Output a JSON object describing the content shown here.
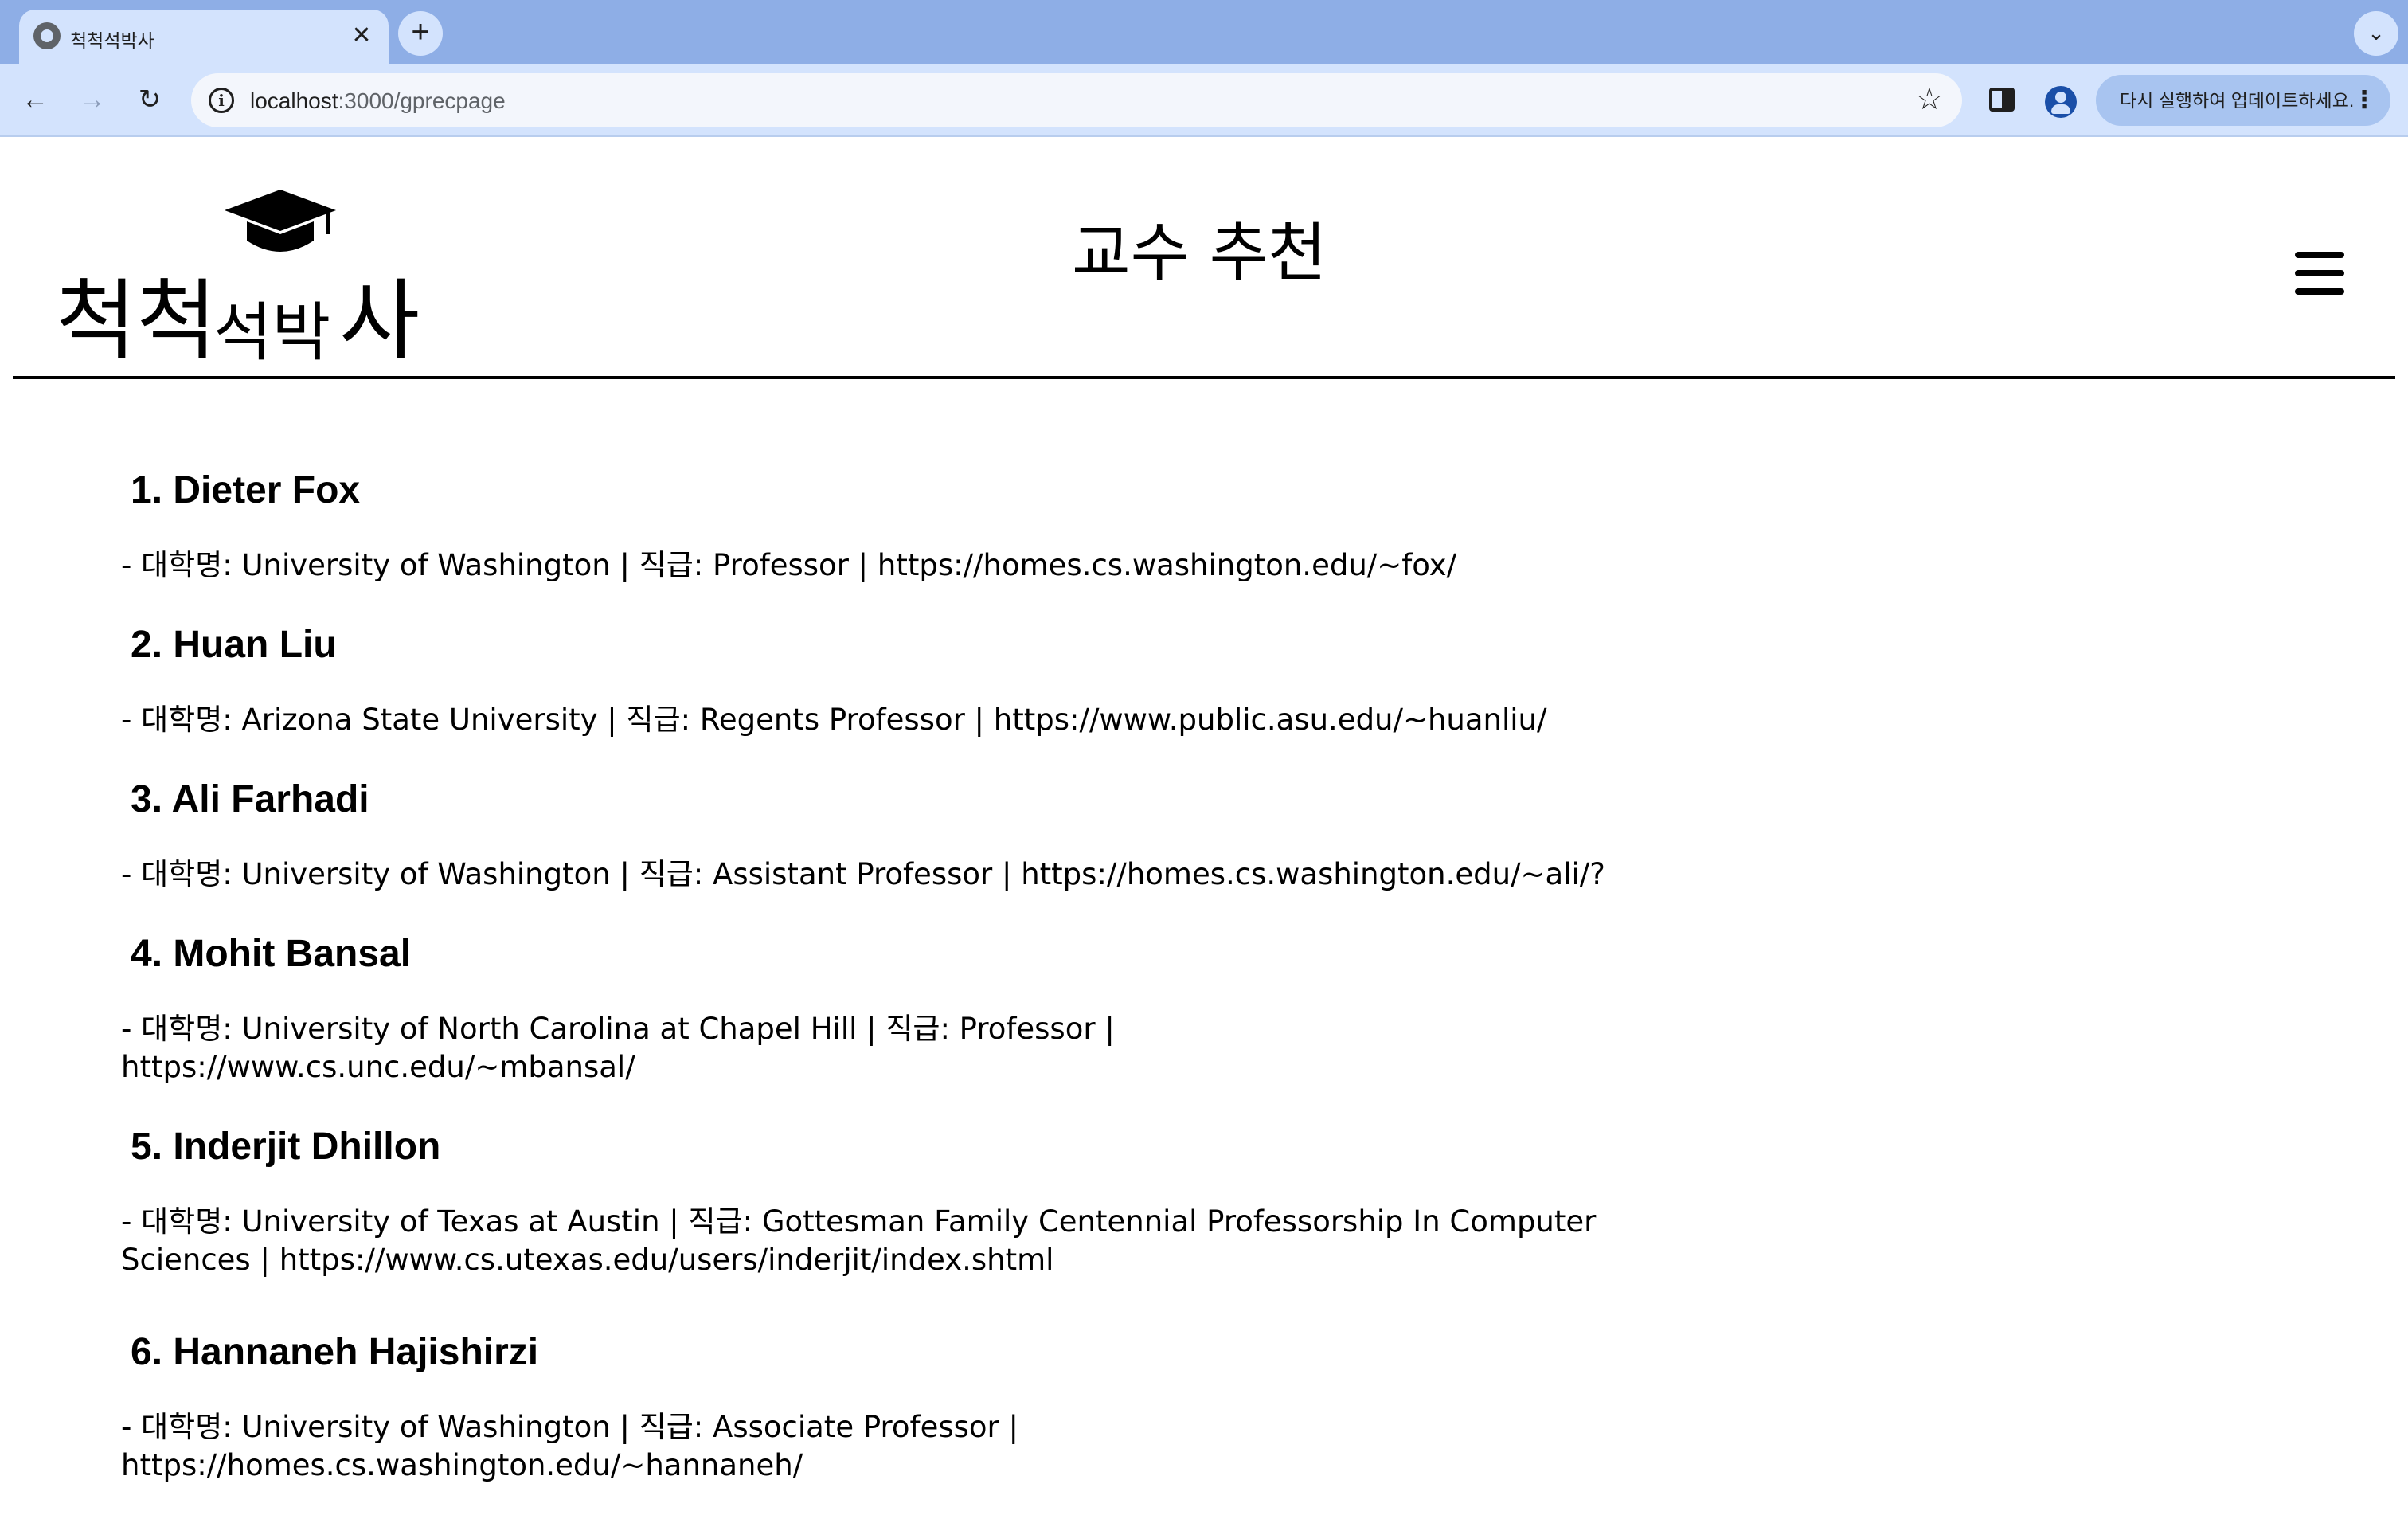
{
  "browser": {
    "tab_title": "척척석박사",
    "url_host": "localhost",
    "url_path": ":3000/gprecpage",
    "update_label": "다시 실행하여 업데이트하세요."
  },
  "icons": {
    "back": "back-arrow-icon",
    "forward": "forward-arrow-icon",
    "reload": "reload-icon",
    "info": "site-info-icon",
    "star": "bookmark-star-icon",
    "sidepanel": "side-panel-icon",
    "profile": "profile-icon",
    "menu": "hamburger-menu-icon",
    "logo_cap": "graduation-cap-icon"
  },
  "header": {
    "logo_word1": "척척",
    "logo_word2": "석박",
    "logo_word3": "사",
    "title": "교수 추천"
  },
  "professors": [
    {
      "name": "1. Dieter Fox",
      "info": "- 대학명: University of Washington | 직급: Professor | https://homes.cs.washington.edu/~fox/"
    },
    {
      "name": "2. Huan Liu",
      "info": "- 대학명: Arizona State University | 직급: Regents Professor | https://www.public.asu.edu/~huanliu/"
    },
    {
      "name": "3. Ali Farhadi",
      "info": "- 대학명: University of Washington | 직급: Assistant Professor | https://homes.cs.washington.edu/~ali/?"
    },
    {
      "name": "4. Mohit Bansal",
      "info": "- 대학명: University of North Carolina at Chapel Hill | 직급: Professor | https://www.cs.unc.edu/~mbansal/"
    },
    {
      "name": "5. Inderjit Dhillon",
      "info": "- 대학명: University of Texas at Austin | 직급: Gottesman Family Centennial Professorship In Computer Sciences | https://www.cs.utexas.edu/users/inderjit/index.shtml"
    },
    {
      "name": "6. Hannaneh Hajishirzi",
      "info": "- 대학명: University of Washington | 직급: Associate Professor | https://homes.cs.washington.edu/~hannaneh/"
    }
  ]
}
